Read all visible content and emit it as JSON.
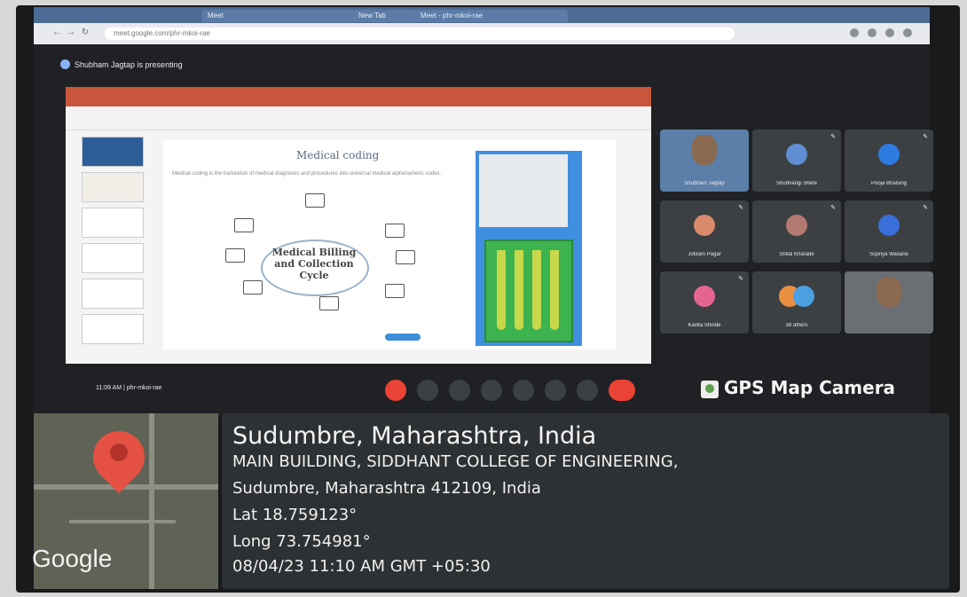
{
  "browser": {
    "tabs": [
      "Meet",
      "New Tab",
      "Meet - phr-mkoi-rae"
    ],
    "address": "meet.google.com/phr-mkoi-rae"
  },
  "meet": {
    "presenting_text": "Shubham Jagtap is presenting",
    "time_code": "11:09 AM | phr-mkoi-rae"
  },
  "slide": {
    "title": "Medical coding",
    "subtitle": "Medical coding is the translation of medical diagnoses and procedures into universal medical alphanumeric codes.",
    "cycle_text": "Medical Billing and Collection Cycle"
  },
  "participants": [
    {
      "name": "Shubham Jagtap",
      "type": "video"
    },
    {
      "name": "Shubhangi Shete",
      "type": "avatar",
      "color": "#5f8fd0"
    },
    {
      "name": "Pooja Bhalsing",
      "type": "avatar",
      "color": "#2d7be0"
    },
    {
      "name": "Jotiram Pagar",
      "type": "avatar",
      "color": "#d88a6a"
    },
    {
      "name": "Shital Kharade",
      "type": "avatar",
      "color": "#b37a72"
    },
    {
      "name": "Supriya Wasane",
      "type": "avatar",
      "color": "#3a6ed8"
    },
    {
      "name": "Kavita Shinde",
      "type": "avatar",
      "color": "#e46590"
    },
    {
      "name": "38 others",
      "type": "avatar",
      "color": "#e89040"
    },
    {
      "name": "",
      "type": "video2"
    }
  ],
  "gps": {
    "brand": "GPS Map Camera",
    "location": "Sudumbre, Maharashtra, India",
    "address1": "MAIN BUILDING, SIDDHANT COLLEGE OF ENGINEERING,",
    "address2": "Sudumbre, Maharashtra 412109, India",
    "lat": "Lat 18.759123°",
    "long": "Long 73.754981°",
    "datetime": "08/04/23 11:10 AM GMT +05:30",
    "map_label": "Google"
  }
}
